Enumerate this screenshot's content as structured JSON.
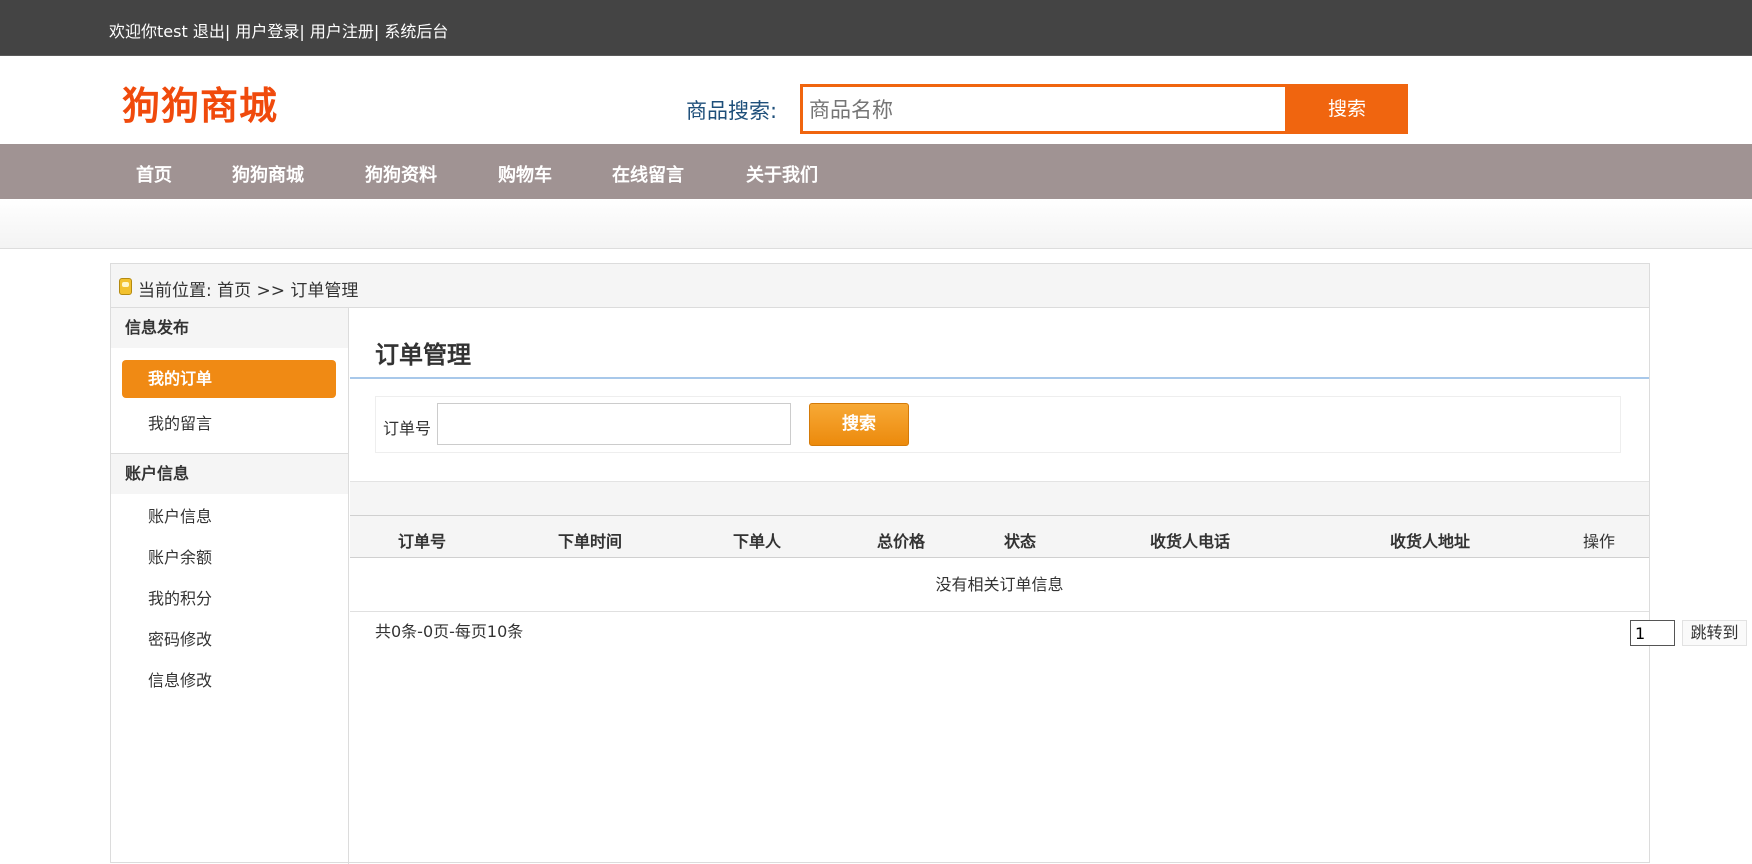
{
  "topbar": {
    "welcome": "欢迎你test",
    "logout": "退出",
    "login": "用户登录",
    "register": "用户注册",
    "admin": "系统后台"
  },
  "header": {
    "logo": "狗狗商城",
    "search_label": "商品搜索:",
    "search_placeholder": "商品名称",
    "search_button": "搜索"
  },
  "nav": {
    "items": [
      "首页",
      "狗狗商城",
      "狗狗资料",
      "购物车",
      "在线留言",
      "关于我们"
    ]
  },
  "breadcrumb": {
    "text": "当前位置: 首页 >> 订单管理"
  },
  "sidebar": {
    "section1_title": "信息发布",
    "section1_items": [
      "我的订单",
      "我的留言"
    ],
    "section2_title": "账户信息",
    "section2_items": [
      "账户信息",
      "账户余额",
      "我的积分",
      "密码修改",
      "信息修改"
    ]
  },
  "main": {
    "title": "订单管理",
    "filter_label": "订单号",
    "filter_value": "",
    "filter_button": "搜索",
    "columns": [
      "订单号",
      "下单时间",
      "下单人",
      "总价格",
      "状态",
      "收货人电话",
      "收货人地址",
      "操作"
    ],
    "empty_text": "没有相关订单信息",
    "pager_info": "共0条-0页-每页10条",
    "pager_page": "1",
    "pager_jump": "跳转到"
  },
  "colors": {
    "accent_orange": "#f0650f",
    "logo_red": "#f04a0c",
    "nav_bg": "#a09393",
    "topbar_bg": "#444444",
    "active_item": "#f08a14"
  }
}
